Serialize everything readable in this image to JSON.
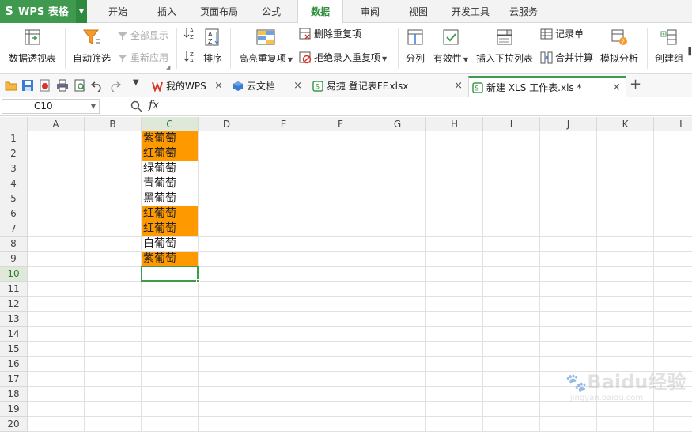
{
  "app": {
    "title": "WPS 表格"
  },
  "menu": {
    "items": [
      "开始",
      "插入",
      "页面布局",
      "公式",
      "数据",
      "审阅",
      "视图",
      "开发工具",
      "云服务"
    ],
    "active": "数据"
  },
  "ribbon": {
    "pivot": "数据透视表",
    "autofilter": "自动筛选",
    "show_all": "全部显示",
    "reapply": "重新应用",
    "sort": "排序",
    "highlight_dup": "高亮重复项",
    "remove_dup": "删除重复项",
    "reject_dup": "拒绝录入重复项",
    "split": "分列",
    "validity": "有效性",
    "dropdown_list": "插入下拉列表",
    "record": "记录单",
    "consolidate": "合并计算",
    "whatif": "模拟分析",
    "group": "创建组"
  },
  "tabs": [
    {
      "label": "我的WPS",
      "icon": "wps-icon"
    },
    {
      "label": "云文档",
      "icon": "cloud-doc-icon"
    },
    {
      "label": "易捷 登记表FF.xlsx",
      "icon": "xlsx-icon"
    },
    {
      "label": "新建 XLS 工作表.xls *",
      "icon": "xls-icon"
    }
  ],
  "active_tab": 3,
  "formula_bar": {
    "name_box": "C10",
    "fx": "fx",
    "content": ""
  },
  "sheet": {
    "columns": [
      "A",
      "B",
      "C",
      "D",
      "E",
      "F",
      "G",
      "H",
      "I",
      "J",
      "K",
      "L"
    ],
    "rows": [
      "1",
      "2",
      "3",
      "4",
      "5",
      "6",
      "7",
      "8",
      "9",
      "10",
      "11",
      "12",
      "13",
      "14",
      "15",
      "16",
      "17",
      "18",
      "19",
      "20"
    ],
    "column_c": [
      {
        "row": "1",
        "value": "紫葡萄",
        "highlight": true
      },
      {
        "row": "2",
        "value": "红葡萄",
        "highlight": true
      },
      {
        "row": "3",
        "value": "绿葡萄",
        "highlight": false
      },
      {
        "row": "4",
        "value": "青葡萄",
        "highlight": false
      },
      {
        "row": "5",
        "value": "黑葡萄",
        "highlight": false
      },
      {
        "row": "6",
        "value": "红葡萄",
        "highlight": true
      },
      {
        "row": "7",
        "value": "红葡萄",
        "highlight": true
      },
      {
        "row": "8",
        "value": "白葡萄",
        "highlight": false
      },
      {
        "row": "9",
        "value": "紫葡萄",
        "highlight": true
      }
    ],
    "selected_cell": "C10",
    "highlight_color": "#ff9900",
    "accent_color": "#3f9a4f"
  },
  "watermark": {
    "text": "Baidu经验",
    "url": "jingyan.baidu.com"
  }
}
